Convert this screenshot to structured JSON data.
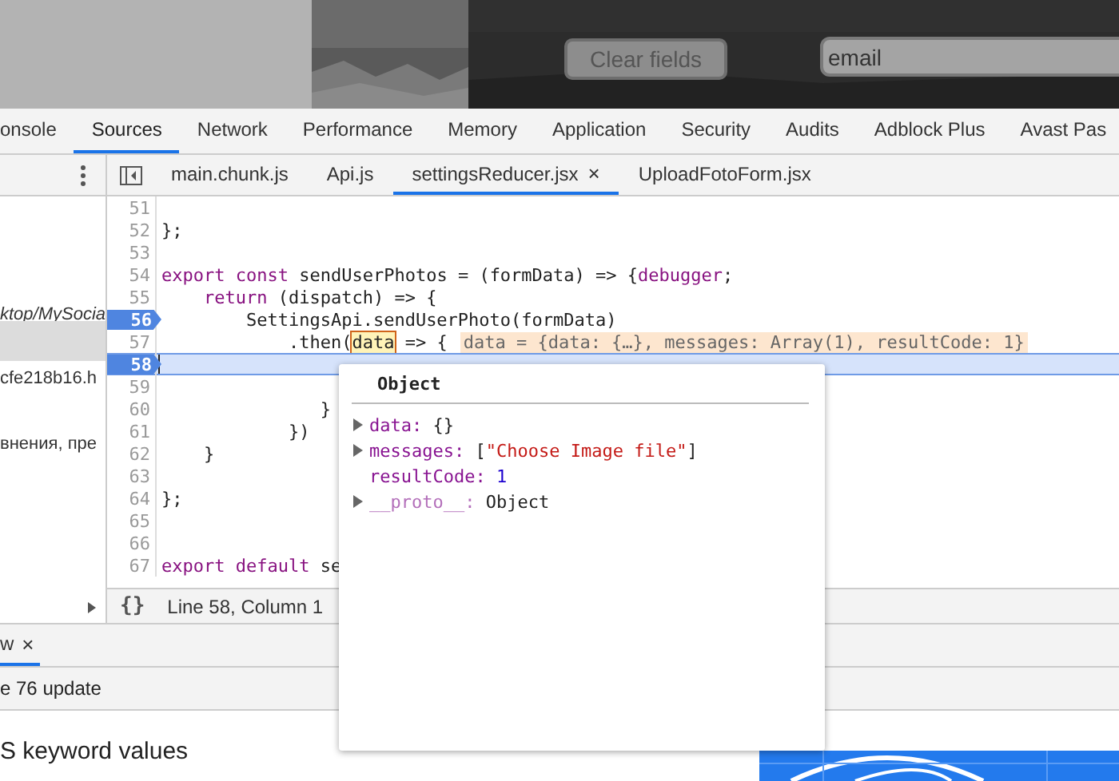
{
  "webpage": {
    "clear_button": {
      "label": "Clear fields"
    },
    "email_field": {
      "placeholder": "email"
    }
  },
  "devtools_tabs": [
    {
      "label": "onsole",
      "selected": false
    },
    {
      "label": "Sources",
      "selected": true
    },
    {
      "label": "Network",
      "selected": false
    },
    {
      "label": "Performance",
      "selected": false
    },
    {
      "label": "Memory",
      "selected": false
    },
    {
      "label": "Application",
      "selected": false
    },
    {
      "label": "Security",
      "selected": false
    },
    {
      "label": "Audits",
      "selected": false
    },
    {
      "label": "Adblock Plus",
      "selected": false
    },
    {
      "label": "Avast Pas",
      "selected": false
    }
  ],
  "navigator": {
    "items": [
      {
        "text": "ktop/MySocia",
        "kind": "folder"
      },
      {
        "kind": "highlight"
      },
      {
        "text": "cfe218b16.h",
        "kind": "file"
      },
      {
        "text": "внения, пре",
        "kind": "file"
      }
    ]
  },
  "file_tabs": [
    {
      "label": "main.chunk.js",
      "selected": false
    },
    {
      "label": "Api.js",
      "selected": false
    },
    {
      "label": "settingsReducer.jsx",
      "selected": true,
      "close": "×"
    },
    {
      "label": "UploadFotoForm.jsx",
      "selected": false
    }
  ],
  "code_lines": [
    {
      "number": "51",
      "breakpoint": false,
      "current": false
    },
    {
      "number": "52",
      "breakpoint": false,
      "current": false,
      "tokens": [
        {
          "text": "};",
          "kind": "plain"
        }
      ]
    },
    {
      "number": "53",
      "breakpoint": false,
      "current": false
    },
    {
      "number": "54",
      "breakpoint": false,
      "current": false,
      "tokens": [
        {
          "text": "export const",
          "kind": "keyword"
        },
        {
          "text": " sendUserPhotos = (formData) => {",
          "kind": "plain"
        },
        {
          "text": "debugger",
          "kind": "keyword"
        },
        {
          "text": ";",
          "kind": "plain"
        }
      ]
    },
    {
      "number": "55",
      "breakpoint": false,
      "current": false,
      "tokens": [
        {
          "text": "    return",
          "kind": "keyword"
        },
        {
          "text": " (dispatch) => {",
          "kind": "plain"
        }
      ]
    },
    {
      "number": "56",
      "breakpoint": true,
      "current": false,
      "tokens": [
        {
          "text": "        SettingsApi.sendUserPhoto(formData)",
          "kind": "plain"
        }
      ]
    },
    {
      "number": "57",
      "breakpoint": false,
      "current": false,
      "tokens": [
        {
          "text": "            .then(",
          "kind": "plain"
        },
        {
          "text": "data",
          "kind": "hovered"
        },
        {
          "text": " => {",
          "kind": "plain"
        }
      ],
      "inline_value": "data = {data: {…}, messages: Array(1), resultCode: 1}"
    },
    {
      "number": "58",
      "breakpoint": true,
      "current": true
    },
    {
      "number": "59",
      "breakpoint": false,
      "current": false
    },
    {
      "number": "60",
      "breakpoint": false,
      "current": false,
      "tokens": [
        {
          "text": "               }",
          "kind": "plain"
        }
      ]
    },
    {
      "number": "61",
      "breakpoint": false,
      "current": false,
      "tokens": [
        {
          "text": "            })",
          "kind": "plain"
        }
      ]
    },
    {
      "number": "62",
      "breakpoint": false,
      "current": false,
      "tokens": [
        {
          "text": "    }",
          "kind": "plain"
        }
      ]
    },
    {
      "number": "63",
      "breakpoint": false,
      "current": false
    },
    {
      "number": "64",
      "breakpoint": false,
      "current": false,
      "tokens": [
        {
          "text": "};",
          "kind": "plain"
        }
      ]
    },
    {
      "number": "65",
      "breakpoint": false,
      "current": false
    },
    {
      "number": "66",
      "breakpoint": false,
      "current": false
    },
    {
      "number": "67",
      "breakpoint": false,
      "current": false,
      "tokens": [
        {
          "text": "export default",
          "kind": "keyword"
        },
        {
          "text": " se",
          "kind": "plain"
        }
      ]
    }
  ],
  "status_bar": {
    "format_button": "{}",
    "position": "Line 58, Column 1"
  },
  "popover": {
    "title": "Object",
    "properties": [
      {
        "key": "data:",
        "expandable": true,
        "internal": false,
        "value": [
          {
            "text": "{}",
            "kind": "plain"
          }
        ]
      },
      {
        "key": "messages:",
        "expandable": true,
        "internal": false,
        "value": [
          {
            "text": "[",
            "kind": "plain"
          },
          {
            "text": "\"Choose Image file\"",
            "kind": "string"
          },
          {
            "text": "]",
            "kind": "plain"
          }
        ]
      },
      {
        "key": "resultCode:",
        "expandable": false,
        "internal": false,
        "value": [
          {
            "text": "1",
            "kind": "number"
          }
        ]
      },
      {
        "key": "__proto__:",
        "expandable": true,
        "internal": true,
        "value": [
          {
            "text": "Object",
            "kind": "plain"
          }
        ]
      }
    ]
  },
  "drawer": {
    "tabs": [
      {
        "label": "w",
        "selected": true,
        "close": "×"
      }
    ],
    "info": "e 76 update",
    "heading": "S keyword values"
  }
}
